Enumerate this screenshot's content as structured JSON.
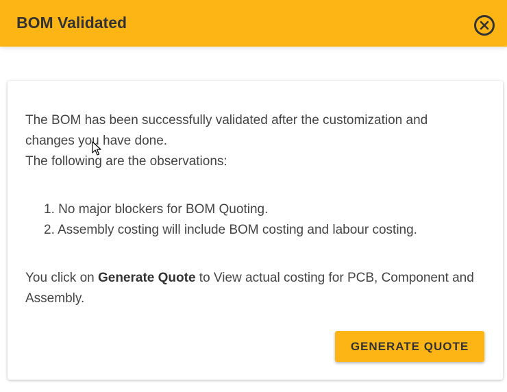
{
  "dialog": {
    "title": "BOM Validated",
    "close_icon": "close-circle-icon",
    "accent_color": "#FDB515"
  },
  "body": {
    "intro_line_1": "The BOM has been successfully validated after the customization and changes you have done.",
    "intro_line_2": "The following are the observations:",
    "observations": [
      {
        "number": "1.",
        "text": "No major blockers for BOM Quoting."
      },
      {
        "number": "2.",
        "text": "Assembly costing will include BOM costing and labour costing."
      }
    ],
    "footer_prefix": "You click on ",
    "footer_bold": "Generate Quote",
    "footer_suffix": " to View actual costing for PCB, Component and Assembly."
  },
  "actions": {
    "generate_label": "GENERATE QUOTE"
  },
  "cursor": {
    "icon": "mouse-pointer-icon"
  }
}
